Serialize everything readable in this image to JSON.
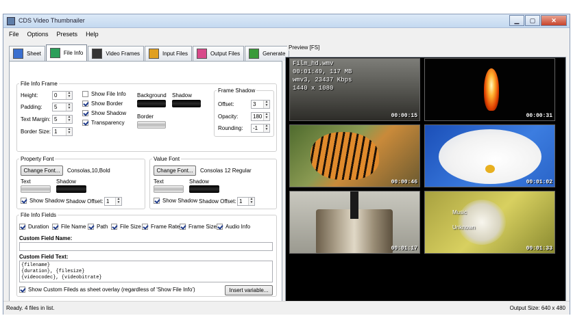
{
  "window": {
    "title": "CDS Video Thumbnailer"
  },
  "menu": [
    "File",
    "Options",
    "Presets",
    "Help"
  ],
  "tabs": [
    {
      "label": "Sheet",
      "icon": "sheet-icon",
      "color": "#3a6fcf"
    },
    {
      "label": "File Info",
      "icon": "file-info-icon",
      "color": "#2c9f5a"
    },
    {
      "label": "Video Frames",
      "icon": "video-frames-icon",
      "color": "#333333"
    },
    {
      "label": "Input Files",
      "icon": "input-files-icon",
      "color": "#e0a020"
    },
    {
      "label": "Output Files",
      "icon": "output-files-icon",
      "color": "#d84a8a"
    },
    {
      "label": "Generate",
      "icon": "generate-icon",
      "color": "#3a9a3a"
    }
  ],
  "file_info_frame": {
    "legend": "File Info Frame",
    "height_label": "Height:",
    "height": "0",
    "padding_label": "Padding:",
    "padding": "5",
    "text_margin_label": "Text Margin:",
    "text_margin": "5",
    "border_size_label": "Border Size:",
    "border_size": "1",
    "show_file_info": "Show File Info",
    "show_border": "Show Border",
    "show_shadow": "Show Shadow",
    "transparency": "Transparency",
    "background_label": "Background",
    "shadow_label": "Shadow",
    "border_label": "Border"
  },
  "frame_shadow": {
    "legend": "Frame Shadow",
    "offset_label": "Offset:",
    "offset": "3",
    "opacity_label": "Opacity:",
    "opacity": "180",
    "rounding_label": "Rounding:",
    "rounding": "-1"
  },
  "property_font": {
    "legend": "Property Font",
    "change_font": "Change Font...",
    "font_value": "Consolas,10,Bold",
    "text_label": "Text",
    "shadow_label": "Shadow",
    "show_shadow": "Show Shadow",
    "shadow_offset_label": "Shadow Offset:",
    "shadow_offset": "1"
  },
  "value_font": {
    "legend": "Value Font",
    "change_font": "Change Font...",
    "font_value": "Consolas 12 Regular",
    "text_label": "Text",
    "shadow_label": "Shadow",
    "show_shadow": "Show Shadow",
    "shadow_offset_label": "Shadow Offset:",
    "shadow_offset": "1"
  },
  "file_info_fields": {
    "legend": "File Info Fields",
    "fields": [
      "Duration",
      "File Name",
      "Path",
      "File Size",
      "Frame Rate",
      "Frame Size",
      "Audio Info"
    ],
    "custom_field_name_label": "Custom Field Name:",
    "custom_field_text_label": "Custom Field Text:",
    "custom_text_lines": [
      "{filename}",
      "{duration}, {filesize}",
      "{videocodec}, {videobitrate}"
    ],
    "show_overlay": "Show Custom Fileds as sheet overlay (regardless of 'Show File Info')",
    "insert_variable": "Insert variable..."
  },
  "preview": {
    "label": "Preview  [FS]",
    "overlay_lines": [
      "Film_hd.wmv",
      "00:01:49, 117 MB",
      "wmv3, 23437 Kbps",
      "1440 x 1080"
    ],
    "thumbs": [
      {
        "time": "00:00:15",
        "scene": "street"
      },
      {
        "time": "00:00:31",
        "scene": "flame"
      },
      {
        "time": "00:00:46",
        "scene": "tiger"
      },
      {
        "time": "00:01:02",
        "scene": "orchid"
      },
      {
        "time": "00:01:17",
        "scene": "can"
      },
      {
        "time": "00:01:33",
        "scene": "dandelion",
        "caption_lines": [
          "Music",
          "Unknown"
        ]
      }
    ]
  },
  "status": {
    "left": "Ready. 4 files in list.",
    "right": "Output Size: 640 x 480"
  }
}
